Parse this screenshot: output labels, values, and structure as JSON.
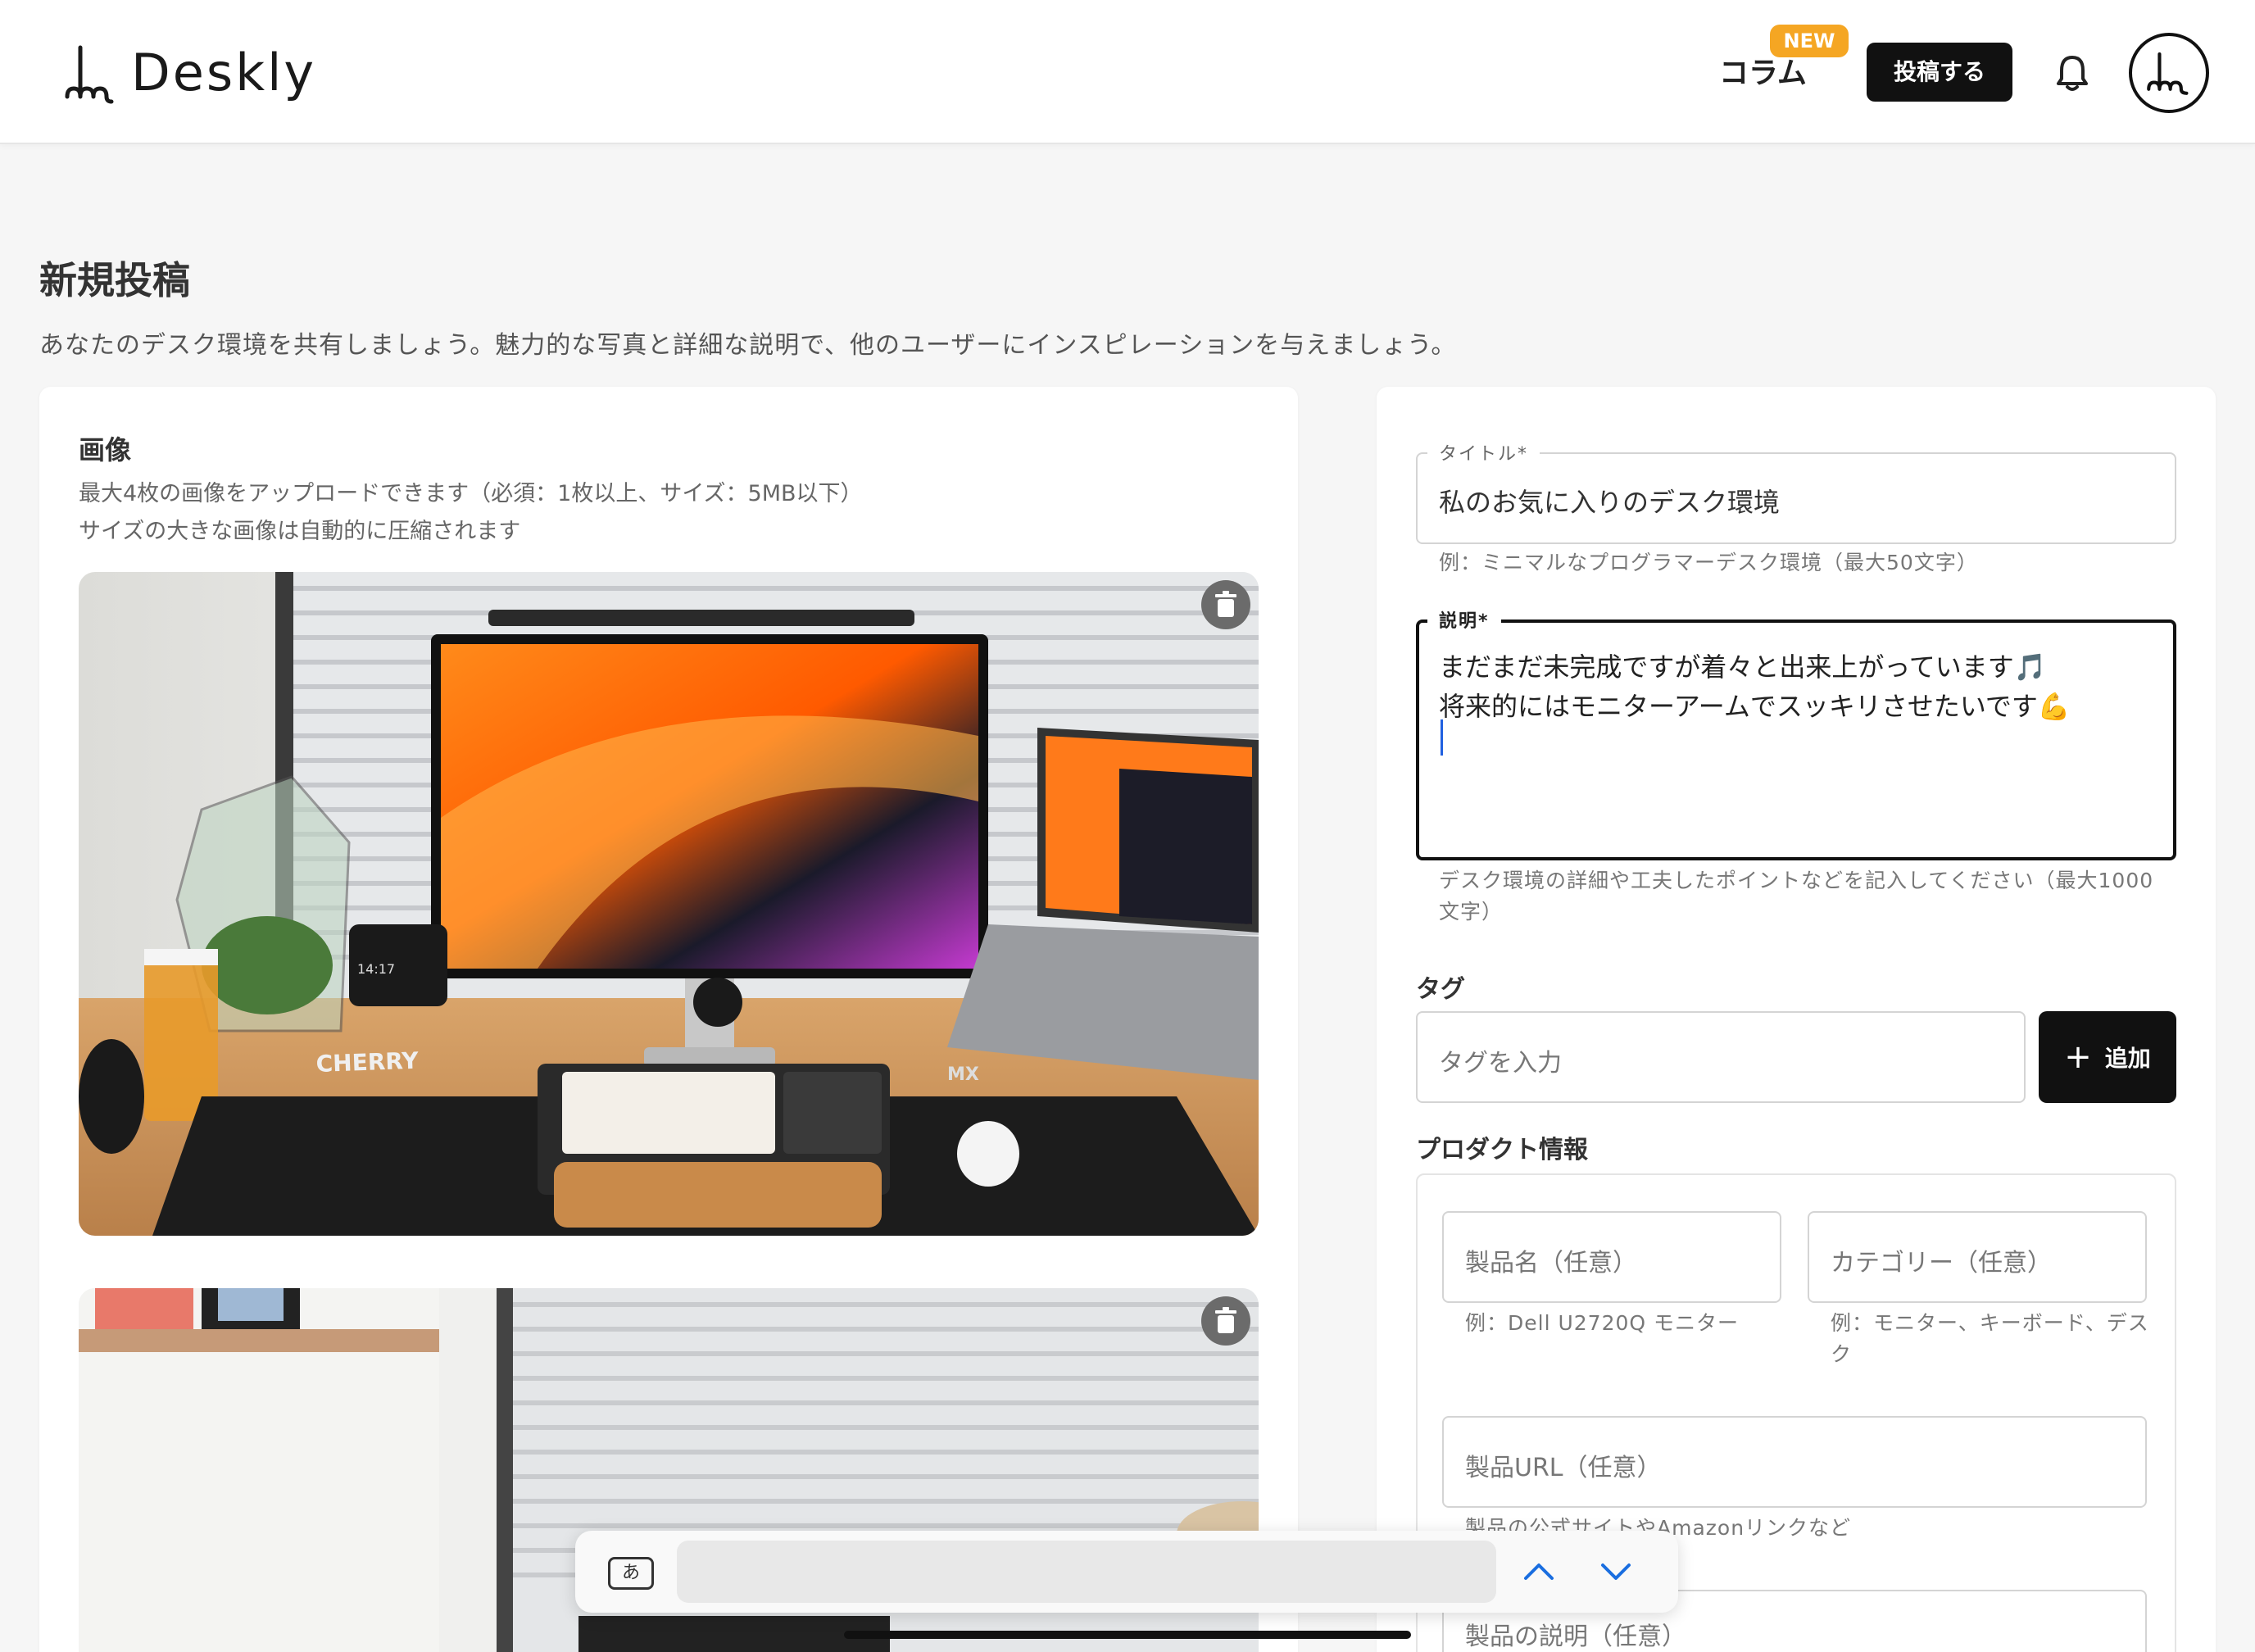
{
  "header": {
    "logo_text": "Deskly",
    "nav_column": "コラム",
    "new_badge": "NEW",
    "post_button": "投稿する"
  },
  "page": {
    "title": "新規投稿",
    "description": "あなたのデスク環境を共有しましょう。魅力的な写真と詳細な説明で、他のユーザーにインスピレーションを与えましょう。"
  },
  "images": {
    "title": "画像",
    "help_line1": "最大4枚の画像をアップロードできます（必須：1枚以上、サイズ：5MB以下）",
    "help_line2": "サイズの大きな画像は自動的に圧縮されます",
    "photo1_labels": {
      "brand": "CHERRY",
      "time": "14:17",
      "pad_brand": "MX"
    }
  },
  "form": {
    "title_label": "タイトル*",
    "title_value": "私のお気に入りのデスク環境",
    "title_helper": "例：ミニマルなプログラマーデスク環境（最大50文字）",
    "desc_label": "説明*",
    "desc_line1": "まだまだ未完成ですが着々と出来上がっています🎵",
    "desc_line2": "将来的にはモニターアームでスッキリさせたいです💪",
    "desc_helper": "デスク環境の詳細や工夫したポイントなどを記入してください（最大1000文字）",
    "tag_section": "タグ",
    "tag_placeholder": "タグを入力",
    "add_button": "追加",
    "product_section": "プロダクト情報",
    "product_name_placeholder": "製品名（任意）",
    "product_name_helper": "例：Dell U2720Q モニター",
    "category_placeholder": "カテゴリー（任意）",
    "category_helper": "例：モニター、キーボード、デスク",
    "url_placeholder": "製品URL（任意）",
    "url_helper": "製品の公式サイトやAmazonリンクなど",
    "product_desc_placeholder": "製品の説明（任意）"
  },
  "findbar": {
    "keyboard_label": "あ"
  },
  "colors": {
    "accent_badge": "#f5a623",
    "primary_button": "#111111",
    "caret": "#2060e0"
  },
  "icons": [
    "logo-icon",
    "bell-icon",
    "trash-icon",
    "plus-icon",
    "chevron-up-icon",
    "chevron-down-icon"
  ]
}
